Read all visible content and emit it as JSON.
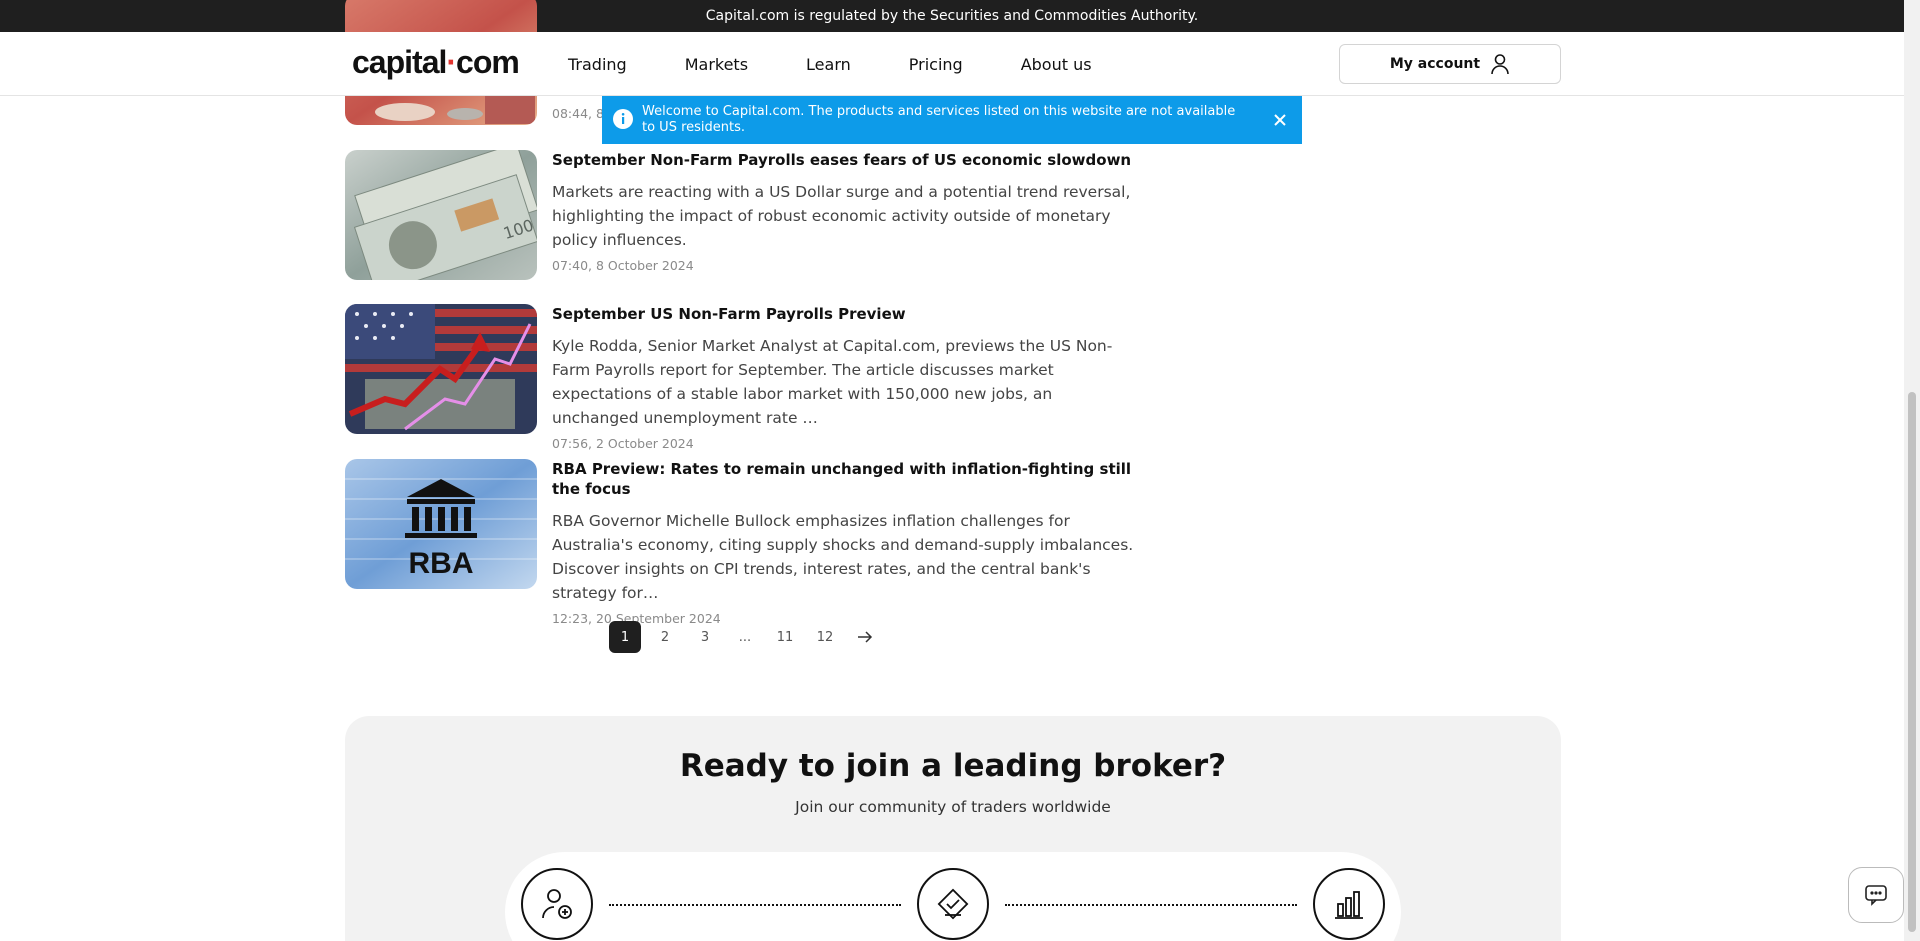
{
  "regulation_bar": {
    "text": "Capital.com is regulated by the Securities and Commodities Authority."
  },
  "header": {
    "logo_left": "capital",
    "logo_dot": "·",
    "logo_right": "com",
    "nav": [
      "Trading",
      "Markets",
      "Learn",
      "Pricing",
      "About us"
    ],
    "account_label": "My account",
    "account_icon": "user-icon"
  },
  "notice": {
    "text": "Welcome to Capital.com. The products and services listed on this website are not available to US residents.",
    "icon": "info-icon",
    "close_icon": "close-icon"
  },
  "articles": [
    {
      "title": "",
      "description": "",
      "date": "08:44, 8"
    },
    {
      "title": "September Non-Farm Payrolls eases fears of US economic slowdown",
      "description": "Markets are reacting with a US Dollar surge and a potential trend reversal, highlighting the impact of robust economic activity outside of monetary policy influences.",
      "date": "07:40, 8 October 2024"
    },
    {
      "title": "September US Non-Farm Payrolls Preview",
      "description": "Kyle Rodda, Senior Market Analyst at Capital.com, previews the US Non-Farm Payrolls report for September. The article discusses market expectations of a stable labor market with 150,000 new jobs, an unchanged unemployment rate …",
      "date": "07:56, 2 October 2024"
    },
    {
      "title": "RBA Preview: Rates to remain unchanged with inflation-fighting still the focus",
      "description": "RBA Governor Michelle Bullock emphasizes inflation challenges for Australia's economy, citing supply shocks and demand-supply imbalances. Discover insights on CPI trends, interest rates, and the central bank's strategy for…",
      "date": "12:23, 20 September 2024",
      "image_text": "RBA"
    }
  ],
  "pagination": {
    "pages": [
      "1",
      "2",
      "3",
      "...",
      "11",
      "12"
    ],
    "active": "1",
    "next_icon": "arrow-right-icon"
  },
  "cta": {
    "title": "Ready to join a leading broker?",
    "subtitle": "Join our community of traders worldwide",
    "step_icons": [
      "user-add-icon",
      "verify-icon",
      "chart-bars-icon"
    ]
  },
  "chat": {
    "icon": "chat-icon"
  }
}
